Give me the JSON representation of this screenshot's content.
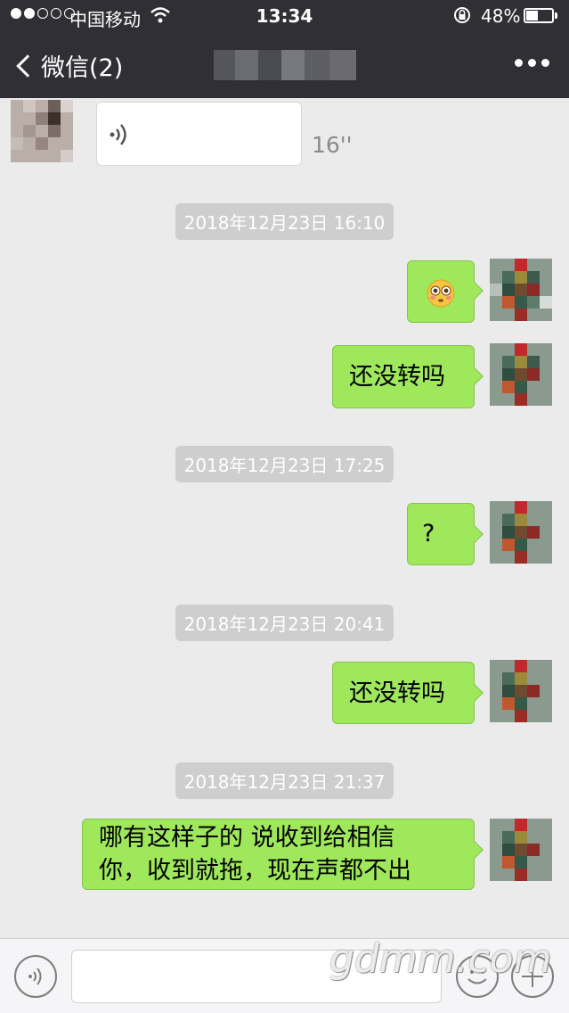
{
  "status_bar": {
    "carrier": "中国移动",
    "time": "13:34",
    "battery_percent": "48%",
    "battery_level": 0.48,
    "wifi_icon": "wifi-icon",
    "lock_icon": "rotation-lock-icon"
  },
  "nav": {
    "back_label": "微信(2)",
    "back_icon": "chevron-left-icon",
    "more_icon": "more-dots-icon"
  },
  "messages": [
    {
      "type": "voice",
      "side": "left",
      "duration": "16''"
    },
    {
      "type": "timestamp",
      "text": "2018年12月23日 16:10"
    },
    {
      "type": "emoji",
      "side": "right",
      "icon": "flushed-face-emoji"
    },
    {
      "type": "text",
      "side": "right",
      "text": "还没转吗"
    },
    {
      "type": "timestamp",
      "text": "2018年12月23日 17:25"
    },
    {
      "type": "text",
      "side": "right",
      "text": "?"
    },
    {
      "type": "timestamp",
      "text": "2018年12月23日 20:41"
    },
    {
      "type": "text",
      "side": "right",
      "text": "还没转吗"
    },
    {
      "type": "timestamp",
      "text": "2018年12月23日 21:37"
    },
    {
      "type": "text",
      "side": "right",
      "lines": [
        "哪有这样子的 说收到给相信",
        "你，收到就拖，现在声都不出"
      ]
    }
  ],
  "input_bar": {
    "voice_icon": "voice-toggle-icon",
    "emoji_icon": "emoji-icon",
    "plus_icon": "plus-icon"
  },
  "watermark": "gdmm.com",
  "colors": {
    "nav_bg": "#2f2f35",
    "chat_bg": "#ebebeb",
    "bubble_green": "#9fe85c",
    "timestamp_bg": "#cecece"
  }
}
